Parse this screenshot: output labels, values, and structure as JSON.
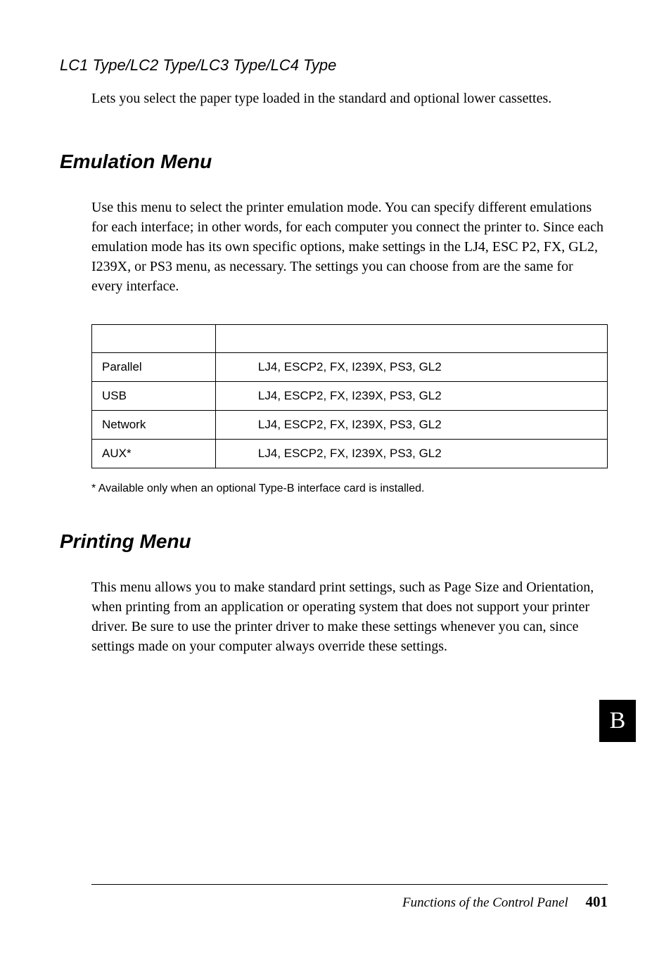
{
  "subsection": {
    "heading": "LC1 Type/LC2 Type/LC3 Type/LC4 Type",
    "body": "Lets you select the paper type loaded in the standard and optional lower cassettes."
  },
  "emulation": {
    "heading": "Emulation Menu",
    "body": "Use this menu to select the printer emulation mode. You can specify different emulations for each interface; in other words, for each computer you connect the printer to. Since each emulation mode has its own specific options, make settings in the LJ4, ESC P2, FX, GL2, I239X, or PS3 menu, as necessary. The settings you can choose from are the same for every interface.",
    "table": {
      "rows": [
        {
          "label": "Parallel",
          "value": "LJ4, ESCP2, FX, I239X, PS3, GL2"
        },
        {
          "label": "USB",
          "value": "LJ4, ESCP2, FX, I239X, PS3, GL2"
        },
        {
          "label": "Network",
          "value": "LJ4, ESCP2, FX, I239X, PS3, GL2"
        },
        {
          "label": "AUX*",
          "value": "LJ4, ESCP2, FX, I239X, PS3, GL2"
        }
      ]
    },
    "footnote": "*  Available only when an optional Type-B interface card is installed."
  },
  "printing": {
    "heading": "Printing Menu",
    "body": "This menu allows you to make standard print settings, such as Page Size and Orientation, when printing from an application or operating system that does not support your printer driver. Be sure to use the printer driver to make these settings whenever you can, since settings made on your computer always override these settings."
  },
  "footer": {
    "title": "Functions of the Control Panel",
    "page": "401"
  },
  "tab": "B"
}
